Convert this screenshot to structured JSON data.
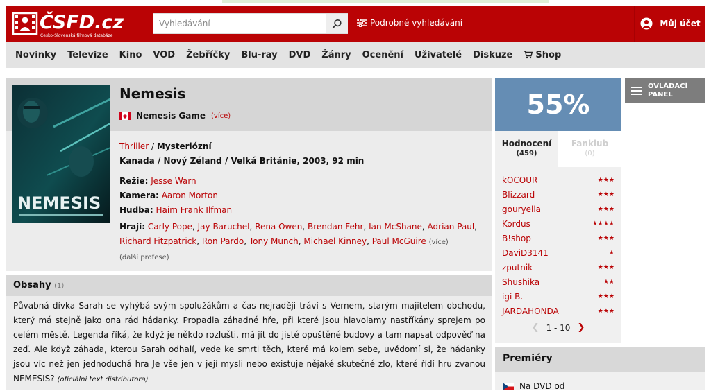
{
  "header": {
    "logo_main": "ČSFD.cz",
    "logo_sub": "Česko-Slovenská filmová databáze",
    "search_placeholder": "Vyhledávání",
    "advanced_search": "Podrobné vyhledávání",
    "account_label": "Můj účet"
  },
  "nav": {
    "items": [
      "Novinky",
      "Televize",
      "Kino",
      "VOD",
      "Žebříčky",
      "Blu-ray",
      "DVD",
      "Žánry",
      "Ocenění",
      "Uživatelé",
      "Diskuze",
      "Shop"
    ]
  },
  "film": {
    "title": "Nemesis",
    "alt_title": "Nemesis Game",
    "alt_more": "(více)",
    "genre_main": "Thriller",
    "genre_sep": " / ",
    "genre_rest": "Mysteriózní",
    "origin": "Kanada / Nový Zéland / Velká Británie, 2003, 92 min",
    "director_label": "Režie:",
    "director": "Jesse Warn",
    "camera_label": "Kamera:",
    "camera": "Aaron Morton",
    "music_label": "Hudba:",
    "music": "Haim Frank Ilfman",
    "cast_label": "Hrají:",
    "cast": [
      "Carly Pope",
      "Jay Baruchel",
      "Rena Owen",
      "Brendan Fehr",
      "Ian McShane",
      "Adrian Paul",
      "Richard Fitzpatrick",
      "Ron Pardo",
      "Tony Munch",
      "Michael Kinney",
      "Paul McGuire"
    ],
    "cast_more": "(více)",
    "more_profession": "(další profese)",
    "poster_text": "NEMESIS"
  },
  "plot": {
    "title": "Obsahy",
    "count": "(1)",
    "text": "Půvabná dívka Sarah se vyhýbá svým spolužákům a čas nejraději tráví s Vernem, starým majitelem obchodu, který má stejně jako ona rád hádanky. Propadla záhadné hře, při které jsou hlavolamy nastříkány sprejem po celém městě. Legenda říká, že když je někdo rozlušti, má jít do jisté opuštěné budovy a tam napsat odpověď na zeď. Ale když záhada, kterou Sarah odhalí, vede ke smrti těch, které má kolem sebe, uvědomí si, že hádanky jsou víc než jen jednoduchá hra Je vše jen v její mysli nebo existuje nějaké skutečné zlo, které řídí hru zvanou NEMESIS?",
    "source": "(oficiální text distributora)"
  },
  "rating": {
    "score": "55%",
    "score_value": 55,
    "tab_ratings": "Hodnocení",
    "tab_ratings_count": "(459)",
    "tab_fanclub": "Fanklub",
    "tab_fanclub_count": "(0)",
    "users": [
      {
        "name": "kOCOUR",
        "stars": 3
      },
      {
        "name": "Blizzard",
        "stars": 3
      },
      {
        "name": "gouryella",
        "stars": 3
      },
      {
        "name": "Kordus",
        "stars": 4
      },
      {
        "name": "B!shop",
        "stars": 3
      },
      {
        "name": "DaviD3141",
        "stars": 1
      },
      {
        "name": "zputnik",
        "stars": 3
      },
      {
        "name": "Shushika",
        "stars": 2
      },
      {
        "name": "igi B.",
        "stars": 3
      },
      {
        "name": "JARDAHONDA",
        "stars": 3
      }
    ],
    "pager": "1 - 10"
  },
  "panel": {
    "line1": "OVLÁDACÍ",
    "line2": "PANEL"
  },
  "premiery": {
    "title": "Premiéry",
    "item": "Na DVD od"
  },
  "colors": {
    "brand_red": "#ba0305",
    "score_blue": "#658db4"
  }
}
